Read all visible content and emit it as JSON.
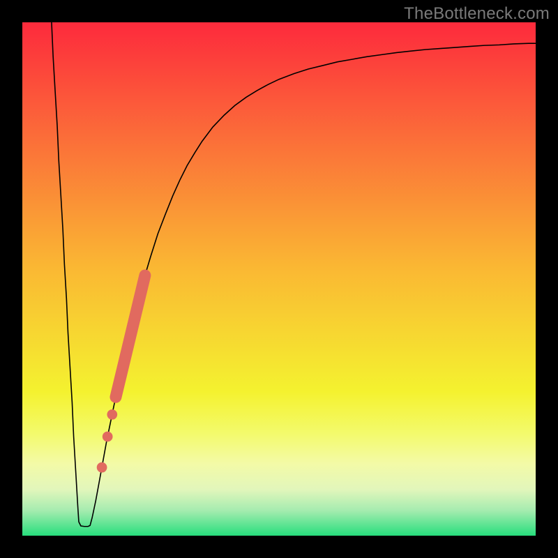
{
  "watermark": "TheBottleneck.com",
  "chart_data": {
    "type": "line",
    "title": "",
    "xlabel": "",
    "ylabel": "",
    "xlim": [
      0,
      100
    ],
    "ylim": [
      0,
      100
    ],
    "grid": false,
    "curve": [
      {
        "x": 5.7,
        "y": 100.0
      },
      {
        "x": 6.0,
        "y": 93.3
      },
      {
        "x": 6.4,
        "y": 86.5
      },
      {
        "x": 6.8,
        "y": 79.8
      },
      {
        "x": 7.1,
        "y": 73.1
      },
      {
        "x": 7.5,
        "y": 66.4
      },
      {
        "x": 7.9,
        "y": 59.6
      },
      {
        "x": 8.2,
        "y": 52.9
      },
      {
        "x": 8.6,
        "y": 46.2
      },
      {
        "x": 8.9,
        "y": 39.5
      },
      {
        "x": 9.3,
        "y": 32.7
      },
      {
        "x": 9.7,
        "y": 26.0
      },
      {
        "x": 10.0,
        "y": 19.3
      },
      {
        "x": 10.4,
        "y": 12.6
      },
      {
        "x": 10.8,
        "y": 5.8
      },
      {
        "x": 11.0,
        "y": 2.7
      },
      {
        "x": 11.4,
        "y": 1.9
      },
      {
        "x": 12.1,
        "y": 1.8
      },
      {
        "x": 12.8,
        "y": 1.8
      },
      {
        "x": 13.2,
        "y": 2.0
      },
      {
        "x": 13.6,
        "y": 3.5
      },
      {
        "x": 14.3,
        "y": 6.8
      },
      {
        "x": 15.0,
        "y": 10.6
      },
      {
        "x": 16.4,
        "y": 18.3
      },
      {
        "x": 17.9,
        "y": 25.6
      },
      {
        "x": 19.3,
        "y": 32.4
      },
      {
        "x": 20.7,
        "y": 38.7
      },
      {
        "x": 22.1,
        "y": 44.4
      },
      {
        "x": 23.6,
        "y": 49.7
      },
      {
        "x": 25.0,
        "y": 54.4
      },
      {
        "x": 26.4,
        "y": 58.8
      },
      {
        "x": 27.9,
        "y": 62.7
      },
      {
        "x": 29.3,
        "y": 66.2
      },
      {
        "x": 30.7,
        "y": 69.3
      },
      {
        "x": 32.1,
        "y": 72.1
      },
      {
        "x": 33.6,
        "y": 74.6
      },
      {
        "x": 35.0,
        "y": 76.8
      },
      {
        "x": 37.1,
        "y": 79.6
      },
      {
        "x": 39.3,
        "y": 81.9
      },
      {
        "x": 41.4,
        "y": 83.8
      },
      {
        "x": 43.6,
        "y": 85.4
      },
      {
        "x": 45.7,
        "y": 86.7
      },
      {
        "x": 47.9,
        "y": 87.9
      },
      {
        "x": 50.0,
        "y": 88.9
      },
      {
        "x": 52.9,
        "y": 90.0
      },
      {
        "x": 55.7,
        "y": 90.9
      },
      {
        "x": 58.6,
        "y": 91.6
      },
      {
        "x": 61.4,
        "y": 92.3
      },
      {
        "x": 64.3,
        "y": 92.8
      },
      {
        "x": 67.1,
        "y": 93.3
      },
      {
        "x": 70.0,
        "y": 93.7
      },
      {
        "x": 72.9,
        "y": 94.1
      },
      {
        "x": 75.7,
        "y": 94.4
      },
      {
        "x": 78.6,
        "y": 94.7
      },
      {
        "x": 81.4,
        "y": 94.9
      },
      {
        "x": 84.3,
        "y": 95.1
      },
      {
        "x": 87.1,
        "y": 95.3
      },
      {
        "x": 90.0,
        "y": 95.5
      },
      {
        "x": 92.9,
        "y": 95.6
      },
      {
        "x": 95.7,
        "y": 95.8
      },
      {
        "x": 98.6,
        "y": 95.9
      },
      {
        "x": 100.0,
        "y": 95.9
      }
    ],
    "markers": [
      {
        "type": "circle",
        "x": 15.5,
        "y": 13.3,
        "r": 1.0
      },
      {
        "type": "circle",
        "x": 16.6,
        "y": 19.3,
        "r": 1.0
      },
      {
        "type": "circle",
        "x": 17.5,
        "y": 23.6,
        "r": 1.0
      },
      {
        "type": "pill",
        "x1": 18.2,
        "y1": 27.0,
        "x2": 23.9,
        "y2": 50.7,
        "w": 2.3
      }
    ],
    "marker_color": "#e16a5f",
    "curve_color": "#000000",
    "background_gradient_stops": [
      {
        "offset": 0.0,
        "color": "#fd2a3c"
      },
      {
        "offset": 0.22,
        "color": "#fb6c39"
      },
      {
        "offset": 0.48,
        "color": "#fab833"
      },
      {
        "offset": 0.72,
        "color": "#f4f22f"
      },
      {
        "offset": 0.8,
        "color": "#f3fa6b"
      },
      {
        "offset": 0.86,
        "color": "#f3faa7"
      },
      {
        "offset": 0.91,
        "color": "#e2f6bb"
      },
      {
        "offset": 0.95,
        "color": "#a7ecb0"
      },
      {
        "offset": 1.0,
        "color": "#27de7d"
      }
    ],
    "frame_color": "#000000",
    "frame_thickness_px": 32
  }
}
